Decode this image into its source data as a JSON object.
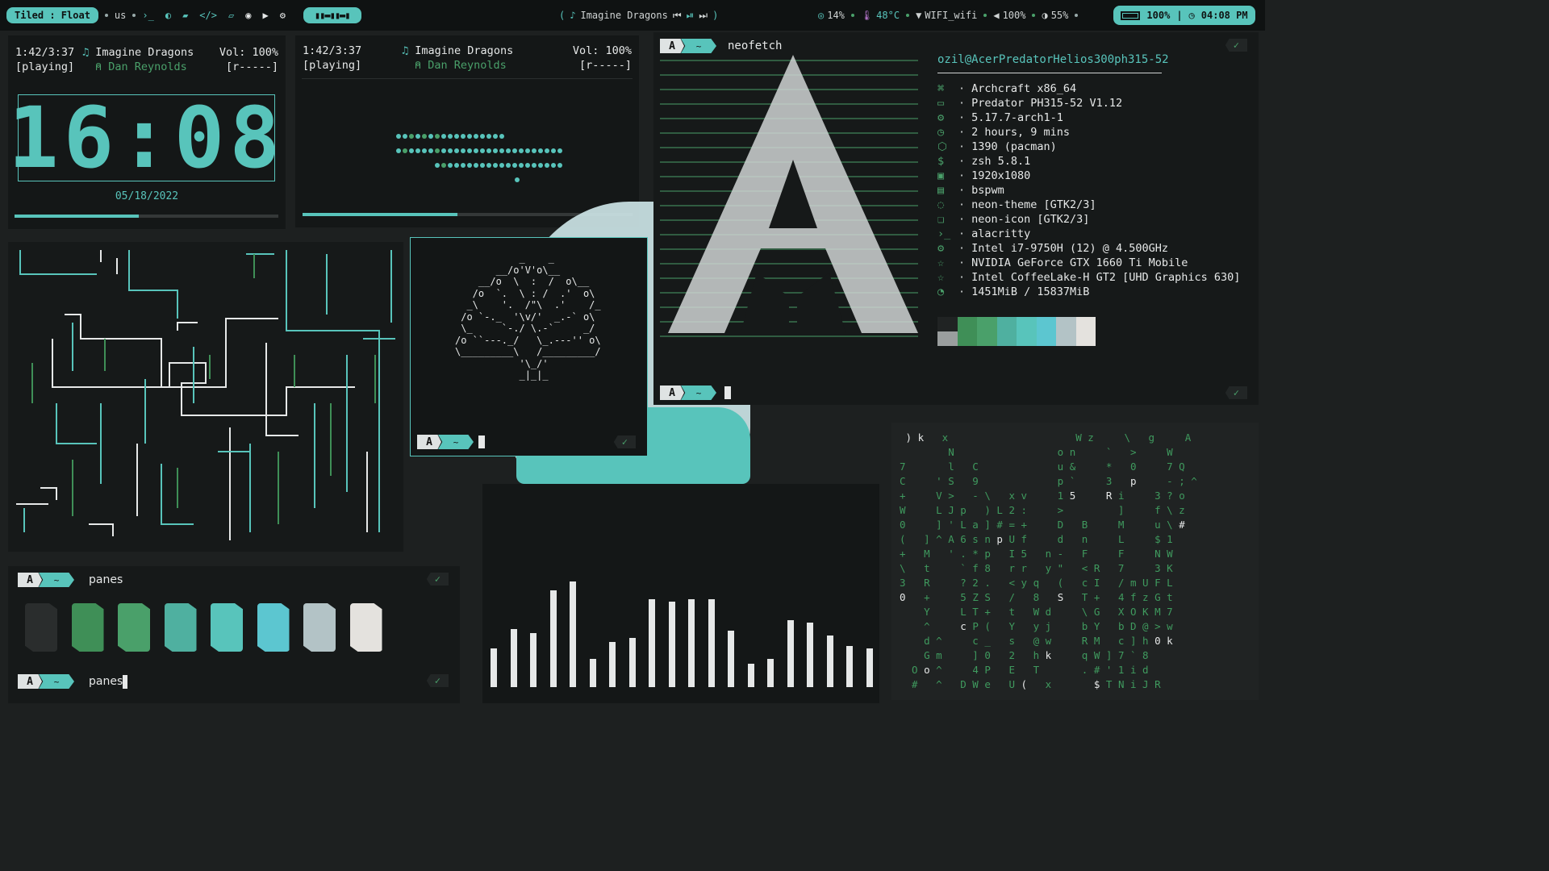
{
  "bar": {
    "layout_mode": "Tiled : Float",
    "keyboard": "us",
    "now_playing": "Imagine Dragons",
    "cpu": "14%",
    "temp": "48°C",
    "wifi": "WIFI_wifi",
    "volume": "100%",
    "brightness": "55%",
    "battery": "100%",
    "time": "04:08 PM"
  },
  "player1": {
    "position": "1:42/3:37",
    "status": "[playing]",
    "artist": "Imagine Dragons",
    "singer": "Dan Reynolds",
    "vol": "Vol: 100%",
    "flags": "[r-----]",
    "clock": "16:08",
    "date": "05/18/2022",
    "progress_pct": 47
  },
  "player2": {
    "position": "1:42/3:37",
    "status": "[playing]",
    "artist": "Imagine Dragons",
    "singer": "Dan Reynolds",
    "vol": "Vol: 100%",
    "flags": "[r-----]",
    "progress_pct": 47
  },
  "neofetch": {
    "command": "neofetch",
    "user_host": "ozil@AcerPredatorHelios300ph315-52",
    "rows": [
      {
        "icon": "⌘",
        "value": "Archcraft x86_64"
      },
      {
        "icon": "▭",
        "value": "Predator PH315-52 V1.12"
      },
      {
        "icon": "⚙",
        "value": "5.17.7-arch1-1"
      },
      {
        "icon": "◷",
        "value": "2 hours, 9 mins"
      },
      {
        "icon": "⬡",
        "value": "1390 (pacman)"
      },
      {
        "icon": "$",
        "value": "zsh 5.8.1"
      },
      {
        "icon": "▣",
        "value": "1920x1080"
      },
      {
        "icon": "▤",
        "value": "bspwm"
      },
      {
        "icon": "◌",
        "value": "neon-theme [GTK2/3]"
      },
      {
        "icon": "❏",
        "value": "neon-icon [GTK2/3]"
      },
      {
        "icon": "›_",
        "value": "alacritty"
      },
      {
        "icon": "⚙",
        "value": "Intel i7-9750H (12) @ 4.500GHz"
      },
      {
        "icon": "☆",
        "value": "NVIDIA GeForce GTX 1660 Ti Mobile"
      },
      {
        "icon": "☆",
        "value": "Intel CoffeeLake-H GT2 [UHD Graphics 630]"
      },
      {
        "icon": "◔",
        "value": "1451MiB / 15837MiB"
      }
    ],
    "palette": [
      "#202323",
      "#3f8f57",
      "#4aa06a",
      "#4fb0a0",
      "#58c4bb",
      "#5cc6d0",
      "#b3c3c6",
      "#e4e2de"
    ]
  },
  "panes": {
    "command": "panes",
    "swatches": [
      "#2a2d2d",
      "#3f8f57",
      "#4aa06a",
      "#4fb0a0",
      "#58c4bb",
      "#5cc6d0",
      "#b3c3c6",
      "#e4e2de"
    ]
  },
  "prompt": {
    "arch": "A",
    "home": "~",
    "check": "✓"
  },
  "visualizer": {
    "heights": [
      0.3,
      0.45,
      0.42,
      0.75,
      0.82,
      0.22,
      0.35,
      0.38,
      0.68,
      0.66,
      0.68,
      0.68,
      0.44,
      0.18,
      0.22,
      0.52,
      0.5,
      0.4,
      0.32,
      0.3
    ]
  }
}
